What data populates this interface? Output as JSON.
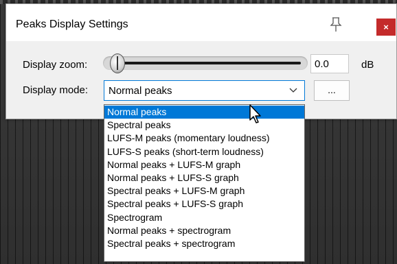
{
  "window": {
    "title": "Peaks Display Settings",
    "close_label": "×"
  },
  "zoom": {
    "label": "Display zoom:",
    "value": "0.0",
    "unit": "dB"
  },
  "mode": {
    "label": "Display mode:",
    "selected": "Normal peaks",
    "more_label": "...",
    "options": [
      "Normal peaks",
      "Spectral peaks",
      "LUFS-M peaks (momentary loudness)",
      "LUFS-S peaks (short-term loudness)",
      "Normal peaks + LUFS-M graph",
      "Normal peaks + LUFS-S graph",
      "Spectral peaks + LUFS-M graph",
      "Spectral peaks + LUFS-S graph",
      "Spectrogram",
      "Normal peaks + spectrogram",
      "Spectral peaks + spectrogram"
    ],
    "highlighted_index": 0
  },
  "colors": {
    "accent": "#0078d7",
    "close_bg": "#c42b2b",
    "dialog_bg": "#f0f0f0"
  },
  "icons": [
    "pin-icon",
    "close-icon",
    "chevron-down-icon",
    "mouse-cursor-icon"
  ]
}
